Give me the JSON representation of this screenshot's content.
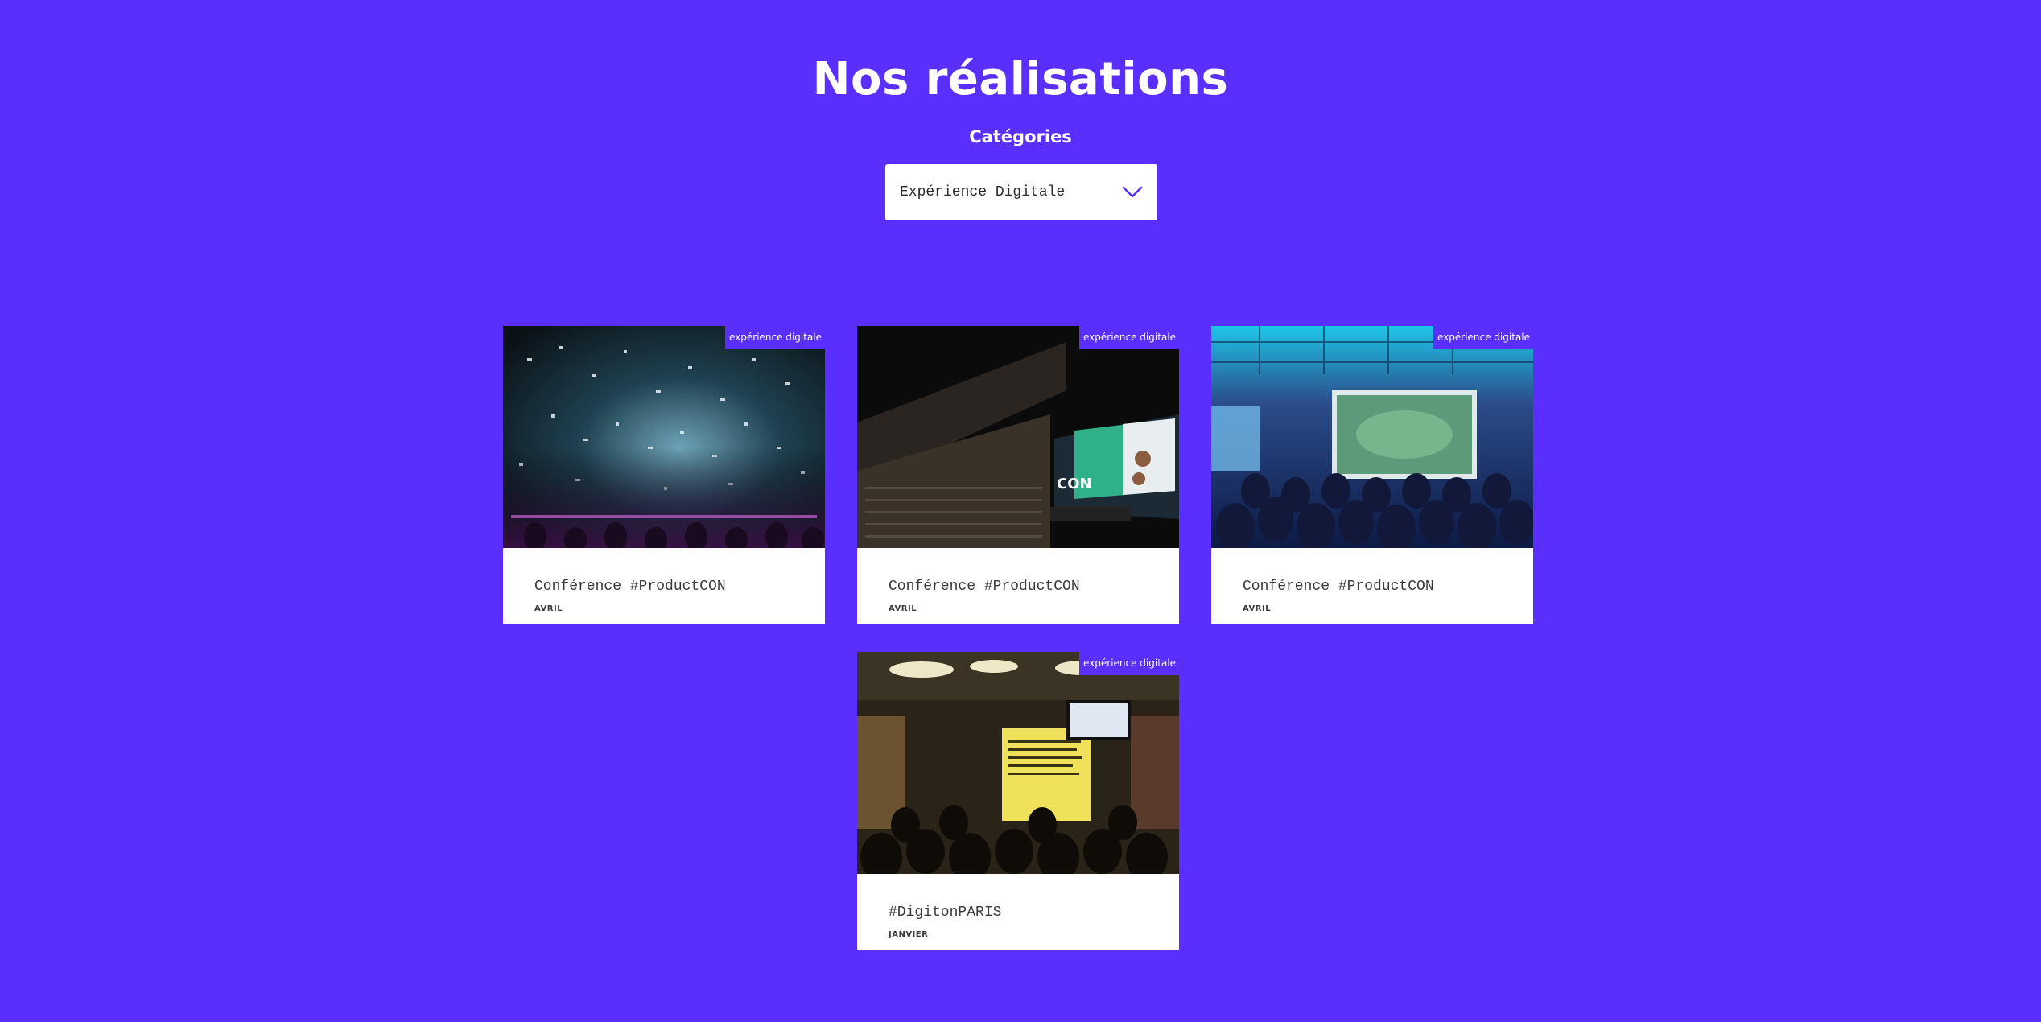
{
  "header": {
    "title": "Nos réalisations"
  },
  "filter": {
    "label": "Catégories",
    "selected": "Expérience Digitale",
    "icon": "chevron-down-icon"
  },
  "projects": [
    {
      "tag": "expérience digitale",
      "title": "Conférence #ProductCON",
      "date": "AVRIL",
      "image": "confetti-crowd-photo"
    },
    {
      "tag": "expérience digitale",
      "title": "Conférence #ProductCON",
      "date": "AVRIL",
      "image": "auditorium-stage-photo"
    },
    {
      "tag": "expérience digitale",
      "title": "Conférence #ProductCON",
      "date": "AVRIL",
      "image": "conference-room-screen-photo"
    },
    {
      "tag": "expérience digitale",
      "title": "#DigitonPARIS",
      "date": "JANVIER",
      "image": "bar-presentation-photo"
    }
  ],
  "colors": {
    "background": "#5a2efc",
    "card": "#ffffff",
    "text": "#3a3a3a"
  }
}
